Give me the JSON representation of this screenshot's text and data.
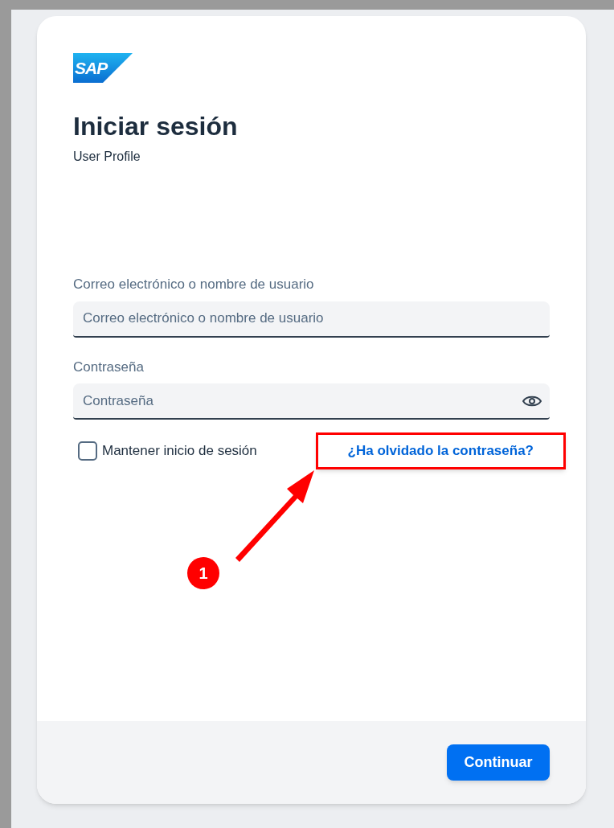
{
  "logo": {
    "text": "SAP"
  },
  "title": "Iniciar sesión",
  "subtitle": "User Profile",
  "fields": [
    {
      "kind": "text",
      "label": "Correo electrónico o nombre de usuario",
      "placeholder": "Correo electrónico o nombre de usuario"
    },
    {
      "kind": "password",
      "label": "Contraseña",
      "placeholder": "Contraseña"
    }
  ],
  "remember": {
    "label": "Mantener inicio de sesión",
    "checked": false
  },
  "forgot_link": "¿Ha olvidado la contraseña?",
  "annotation": {
    "number": "1"
  },
  "buttons": [
    "Continuar"
  ]
}
